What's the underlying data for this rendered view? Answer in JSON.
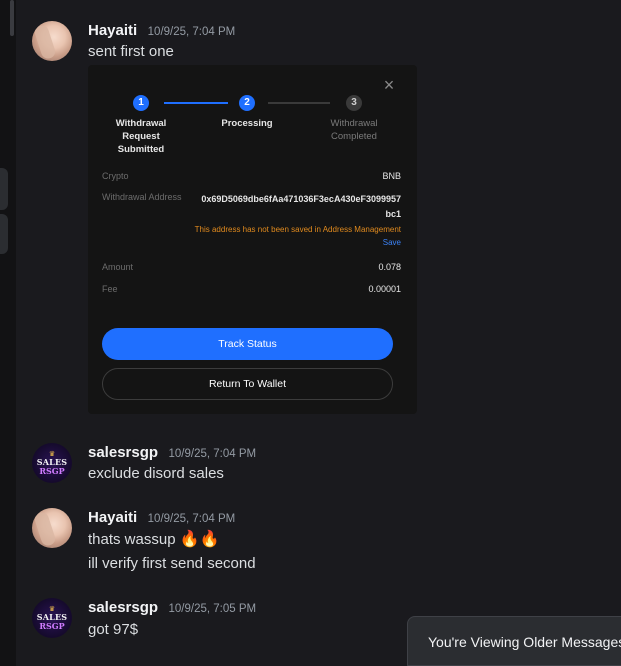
{
  "messages": [
    {
      "username": "Hayaiti",
      "timestamp": "10/9/25, 7:04 PM",
      "lines": [
        "sent first one"
      ]
    },
    {
      "username": "salesrsgp",
      "timestamp": "10/9/25, 7:04 PM",
      "lines": [
        "exclude disord sales"
      ]
    },
    {
      "username": "Hayaiti",
      "timestamp": "10/9/25, 7:04 PM",
      "lines": [
        "thats wassup",
        "ill verify first send second"
      ],
      "emoji": "🔥🔥"
    },
    {
      "username": "salesrsgp",
      "timestamp": "10/9/25, 7:05 PM",
      "lines": [
        "got 97$"
      ]
    }
  ],
  "avatars": {
    "sales": {
      "line1": "SALES",
      "line2": "RSGP",
      "crown": "♛"
    }
  },
  "embed": {
    "close_icon": "×",
    "steps": [
      {
        "number": "1",
        "label": "Withdrawal Request Submitted",
        "state": "done"
      },
      {
        "number": "2",
        "label": "Processing",
        "state": "active"
      },
      {
        "number": "3",
        "label": "Withdrawal Completed",
        "state": "pending"
      }
    ],
    "crypto_label": "Crypto",
    "crypto_value": "BNB",
    "address_label": "Withdrawal Address",
    "address_value": "0x69D5069dbe6fAa471036F3ecA430eF3099957bc1",
    "warning_text": "This address has not been saved in Address Management",
    "save_link": "Save",
    "amount_label": "Amount",
    "amount_value": "0.078",
    "fee_label": "Fee",
    "fee_value": "0.00001",
    "track_button": "Track Status",
    "return_button": "Return To Wallet"
  },
  "toast": {
    "text": "You're Viewing Older Messages"
  },
  "colors": {
    "background": "#1a1a1e",
    "accent_blue": "#1f6fff",
    "warning_orange": "#e08a1e",
    "username": "#f2f3f5",
    "timestamp": "#949ba4"
  }
}
